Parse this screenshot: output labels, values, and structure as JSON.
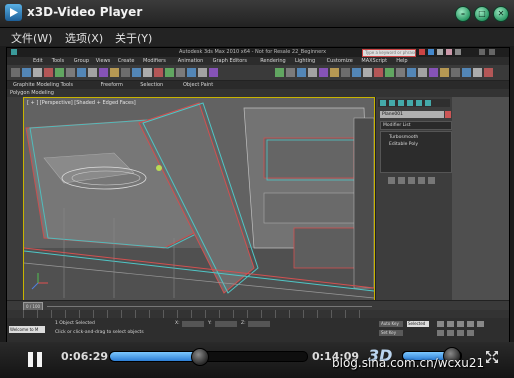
{
  "window": {
    "title": "x3D-Video Player",
    "buttons": [
      "minimize",
      "restore",
      "close"
    ]
  },
  "menu": {
    "items": [
      "文件(W)",
      "选项(X)",
      "关于(Y)"
    ]
  },
  "video_frame": {
    "app_title": "Autodesk 3ds Max 2010 x64 - Not for Resale  22_Beginnerx",
    "search_placeholder": "Type a keyword or phrase",
    "menu_items": [
      "Edit",
      "Tools",
      "Group",
      "Views",
      "Create",
      "Modifiers",
      "Animation",
      "Graph Editors",
      "Rendering",
      "Lighting",
      "Customize",
      "MAXScript",
      "Help"
    ],
    "ribbon_tabs": [
      "Graphite Modeling Tools",
      "Freeform",
      "Selection",
      "Object Paint"
    ],
    "ribbon_sub": "Polygon Modeling",
    "viewport_label": "[ + ] [Perspective] [Shaded + Edged Faces]",
    "command_panel": {
      "object_name": "Plane001",
      "modifier_list": "Modifier List",
      "stack_items": [
        "Turbosmooth",
        "Editable Poly"
      ]
    },
    "timeline": {
      "frame_readout": "0 / 100",
      "status_text": "1 Object Selected",
      "prompt_text": "Click or click-and-drag to select objects",
      "welcome": "Welcome to M",
      "coords": [
        "X:",
        "Y:",
        "Z:"
      ],
      "auto_key": "Auto Key",
      "set_key": "Set Key",
      "selected": "Selected"
    }
  },
  "player": {
    "current_time": "0:06:29",
    "total_time": "0:14:09",
    "progress": 0.45,
    "volume": 0.82,
    "mode_label": "3D"
  },
  "watermark": "blog.sina.com.cn/wcxu21",
  "colors": {
    "seek_fill": "#2d7fd6",
    "titlebar": "#2c2c2c",
    "window_buttons": "#2c9a66"
  }
}
